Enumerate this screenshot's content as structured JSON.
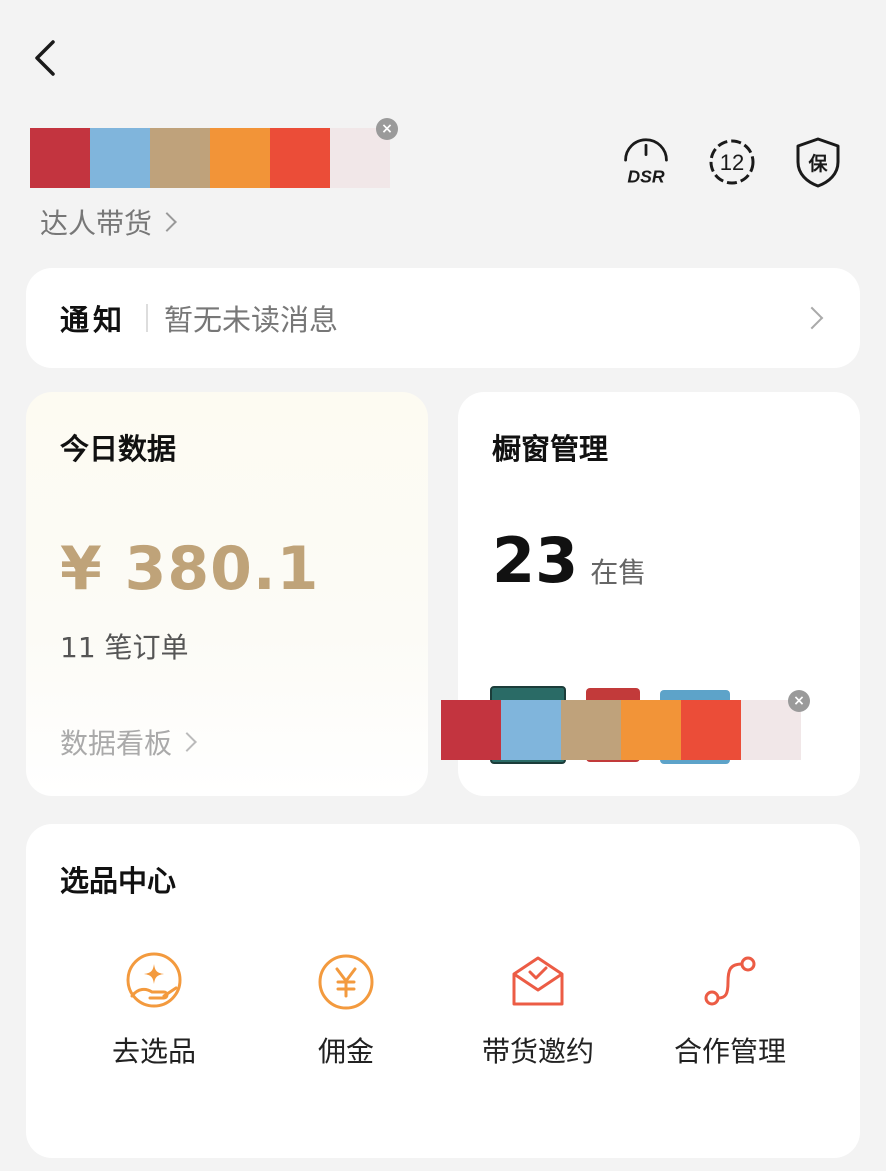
{
  "header": {
    "back_icon": "chevron-left-icon",
    "shop_type_label": "达人带货",
    "palette_colors": [
      "#c3343f",
      "#80b5dc",
      "#bfa27b",
      "#f29438",
      "#eb4d38",
      "#f1e7e8"
    ],
    "icons": [
      "dsr-gauge-icon",
      "level-12-badge-icon",
      "guarantee-shield-icon"
    ],
    "dsr_label": "DSR",
    "level_number": "12",
    "guarantee_char": "保"
  },
  "notice": {
    "title": "通知",
    "message": "暂无未读消息"
  },
  "today": {
    "title": "今日数据",
    "amount": "¥ 380.1",
    "orders": "11 笔订单",
    "board_link": "数据看板"
  },
  "window": {
    "title": "橱窗管理",
    "count": "23",
    "count_suffix": "在售"
  },
  "select_center": {
    "title": "选品中心",
    "items": [
      {
        "label": "去选品",
        "icon": "hand-sparkle-icon"
      },
      {
        "label": "佣金",
        "icon": "yen-coin-icon"
      },
      {
        "label": "带货邀约",
        "icon": "envelope-check-icon"
      },
      {
        "label": "合作管理",
        "icon": "connection-path-icon"
      }
    ],
    "accent_color": "#f39a3e",
    "accent_red": "#ec5c45"
  }
}
